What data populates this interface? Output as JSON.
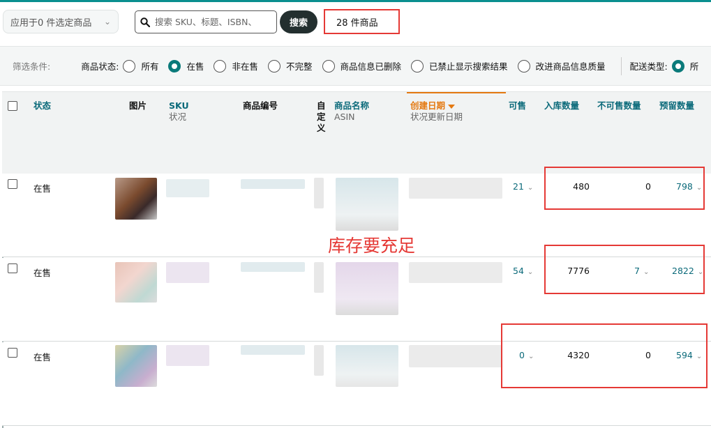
{
  "toolbar": {
    "apply_label": "应用于0 件选定商品",
    "search_placeholder": "搜索 SKU、标题、ISBN、",
    "search_button": "搜索",
    "result_count": "28 件商品"
  },
  "filters": {
    "label": "筛选条件:",
    "status_group": "商品状态:",
    "status_options": [
      "所有",
      "在售",
      "非在售",
      "不完整",
      "商品信息已删除",
      "已禁止显示搜索结果",
      "改进商品信息质量"
    ],
    "selected_status": "在售",
    "delivery_group": "配送类型:",
    "delivery_option_partial": "所"
  },
  "table": {
    "headers": {
      "status": "状态",
      "image": "图片",
      "sku": "SKU",
      "sku_sub": "状况",
      "product_id": "商品编号",
      "custom": "自定义",
      "name": "商品名称",
      "name_sub": "ASIN",
      "created": "创建日期",
      "created_sub": "状况更新日期",
      "available": "可售",
      "inbound": "入库数量",
      "unfulfillable": "不可售数量",
      "reserved": "预留数量"
    },
    "rows": [
      {
        "status": "在售",
        "available": "21",
        "inbound": "480",
        "unfulfillable": "0",
        "reserved": "798"
      },
      {
        "status": "在售",
        "available": "54",
        "inbound": "7776",
        "unfulfillable": "7",
        "reserved": "2822"
      },
      {
        "status": "在售",
        "available": "0",
        "inbound": "4320",
        "unfulfillable": "0",
        "reserved": "594"
      }
    ]
  },
  "annotation": {
    "text": "库存要充足",
    "color": "#e53935"
  },
  "colors": {
    "accent": "#0b6a7a",
    "sort": "#e47911",
    "button_dark": "#232f2f"
  }
}
